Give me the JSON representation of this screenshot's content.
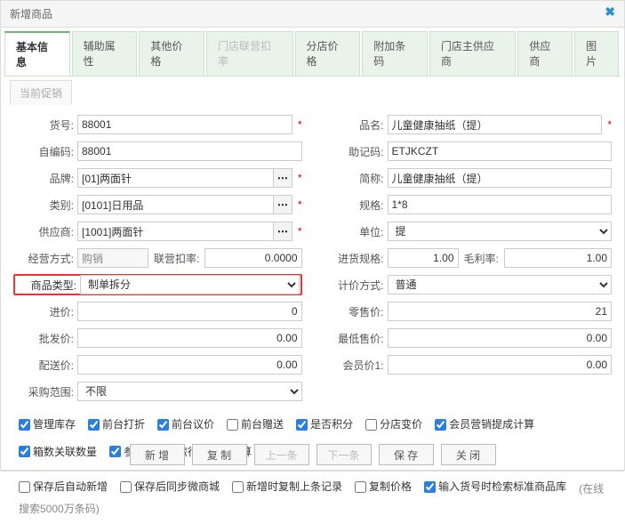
{
  "title": "新增商品",
  "tabs": [
    "基本信息",
    "辅助属性",
    "其他价格",
    "门店联营扣率",
    "分店价格",
    "附加条码",
    "门店主供应商",
    "供应商",
    "图片"
  ],
  "subtab": "当前促销",
  "left": {
    "huohao": {
      "label": "货号:",
      "value": "88001"
    },
    "zibianma": {
      "label": "自编码:",
      "value": "88001"
    },
    "pinpai": {
      "label": "品牌:",
      "value": "[01]两面针"
    },
    "leibie": {
      "label": "类别:",
      "value": "[0101]日用品"
    },
    "gongyingshang": {
      "label": "供应商:",
      "value": "[1001]两面针"
    },
    "jingyingfs": {
      "label": "经营方式:",
      "value": "购销"
    },
    "liankou": {
      "label": "联营扣率:",
      "value": "0.0000"
    },
    "shangpinlx": {
      "label": "商品类型:",
      "value": "制单拆分"
    },
    "jinjia": {
      "label": "进价:",
      "value": "0"
    },
    "pifajia": {
      "label": "批发价:",
      "value": "0.00"
    },
    "peisongjia": {
      "label": "配送价:",
      "value": "0.00"
    },
    "caigoufw": {
      "label": "采购范围:",
      "value": "不限"
    }
  },
  "right": {
    "pinming": {
      "label": "品名:",
      "value": "儿童健康抽纸（提）"
    },
    "zhujima": {
      "label": "助记码:",
      "value": "ETJKCZT"
    },
    "jiancheng": {
      "label": "简称:",
      "value": "儿童健康抽纸（提）"
    },
    "guige": {
      "label": "规格:",
      "value": "1*8"
    },
    "danwei": {
      "label": "单位:",
      "value": "提"
    },
    "jinhuogg": {
      "label": "进货规格:",
      "value": "1.00"
    },
    "maolilv": {
      "label": "毛利率:",
      "value": "1.00"
    },
    "jijiafs": {
      "label": "计价方式:",
      "value": "普通"
    },
    "lingshoujia": {
      "label": "零售价:",
      "value": "21"
    },
    "zuidishoujia": {
      "label": "最低售价:",
      "value": "0.00"
    },
    "huiyuanjia": {
      "label": "会员价1:",
      "value": "0.00"
    }
  },
  "checks1": [
    "管理库存",
    "前台打折",
    "前台议价",
    "前台赠送",
    "是否积分",
    "分店变价",
    "会员营销提成计算"
  ],
  "checks1_state": [
    true,
    true,
    true,
    false,
    true,
    false,
    true
  ],
  "checks2": [
    "箱数关联数量",
    "参与导游、旅行社提成计算"
  ],
  "checks2_state": [
    true,
    true
  ],
  "checks3": [
    "保存后自动新增",
    "保存后同步微商城",
    "新增时复制上条记录",
    "复制价格",
    "输入货号时检索标准商品库"
  ],
  "checks3_state": [
    false,
    false,
    false,
    false,
    true
  ],
  "hint": "(在线搜索5000万条码)",
  "buttons": {
    "xinzeng": "新 增",
    "fuzhi": "复 制",
    "shangyitiao": "上一条",
    "xiayitiao": "下一条",
    "baocun": "保 存",
    "guanbi": "关 闭"
  }
}
